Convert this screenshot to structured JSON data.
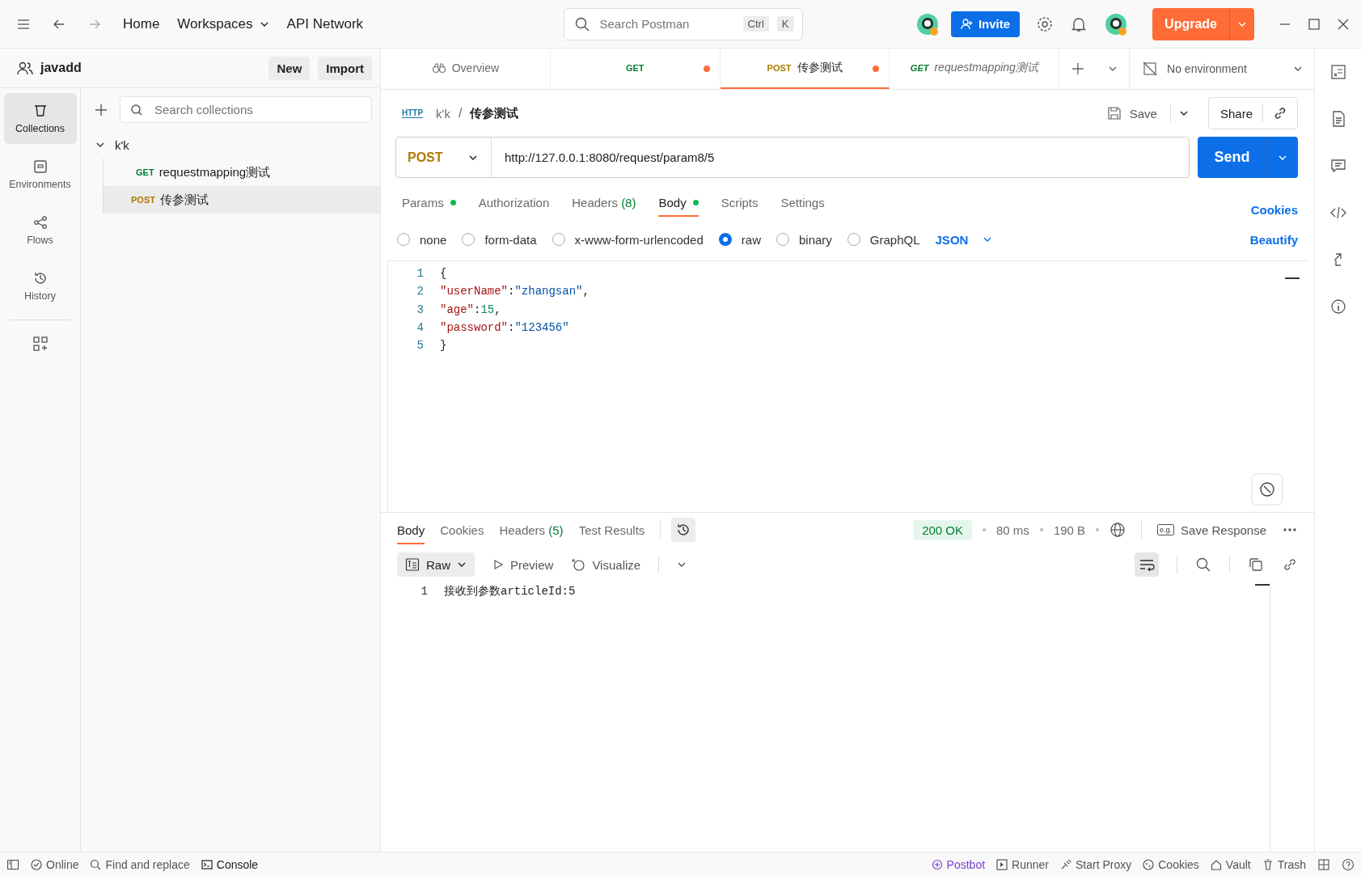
{
  "topbar": {
    "nav": [
      "Home",
      "Workspaces",
      "API Network"
    ],
    "search": {
      "placeholder": "Search Postman",
      "keys": [
        "Ctrl",
        "K"
      ]
    },
    "invite": "Invite",
    "upgrade": "Upgrade"
  },
  "workspace": {
    "name": "javadd",
    "buttons": [
      "New",
      "Import"
    ]
  },
  "nav": [
    {
      "kind": "collections",
      "label": "Collections",
      "selected": true
    },
    {
      "kind": "environments",
      "label": "Environments",
      "selected": false
    },
    {
      "kind": "flows",
      "label": "Flows",
      "selected": false
    },
    {
      "kind": "history",
      "label": "History",
      "selected": false
    }
  ],
  "collections": {
    "search": {
      "placeholder": "Search collections"
    },
    "tree": [
      {
        "name": "k'k",
        "expanded": true,
        "children": [
          {
            "method": "GET",
            "name": "requestmapping测试",
            "selected": false
          },
          {
            "method": "POST",
            "name": "传参测试",
            "selected": true
          }
        ]
      }
    ]
  },
  "tabs": [
    {
      "kind": "overview",
      "label": "Overview",
      "selected": false,
      "unsaved": false,
      "preview": false
    },
    {
      "kind": "request",
      "method": "GET",
      "selected": false,
      "unsaved": true,
      "preview": false
    },
    {
      "kind": "request",
      "method": "POST",
      "label": "传参测试",
      "selected": true,
      "unsaved": true,
      "preview": false
    },
    {
      "kind": "request",
      "method": "GET",
      "label": "requestmapping测试",
      "selected": false,
      "unsaved": false,
      "preview": true
    }
  ],
  "environment": "No environment",
  "request": {
    "protocol": "HTTP",
    "breadcrumb": [
      "k'k",
      "传参测试"
    ],
    "separator": "/",
    "save": "Save",
    "share": "Share",
    "method": "POST",
    "url": "http://127.0.0.1:8080/request/param8/5",
    "send": "Send",
    "tabs": [
      {
        "label": "Params",
        "dot": true,
        "selected": false
      },
      {
        "label": "Authorization",
        "dot": false,
        "selected": false
      },
      {
        "label": "Headers",
        "count": "(8)",
        "dot": false,
        "selected": false
      },
      {
        "label": "Body",
        "dot": true,
        "selected": true
      },
      {
        "label": "Scripts",
        "dot": false,
        "selected": false
      },
      {
        "label": "Settings",
        "dot": false,
        "selected": false
      }
    ],
    "cookies": "Cookies",
    "body_types": [
      {
        "label": "none",
        "selected": false
      },
      {
        "label": "form-data",
        "selected": false
      },
      {
        "label": "x-www-form-urlencoded",
        "selected": false
      },
      {
        "label": "raw",
        "selected": true
      },
      {
        "label": "binary",
        "selected": false
      },
      {
        "label": "GraphQL",
        "selected": false
      }
    ],
    "format": "JSON",
    "beautify": "Beautify",
    "code": [
      {
        "number": "1",
        "tokens": [
          {
            "kind": "punct",
            "text": "{"
          }
        ]
      },
      {
        "number": "2",
        "tokens": [
          {
            "kind": "key",
            "text": "\"userName\""
          },
          {
            "kind": "punct",
            "text": ":"
          },
          {
            "kind": "string",
            "text": "\"zhangsan\""
          },
          {
            "kind": "punct",
            "text": ","
          }
        ]
      },
      {
        "number": "3",
        "tokens": [
          {
            "kind": "key",
            "text": "\"age\""
          },
          {
            "kind": "punct",
            "text": ":"
          },
          {
            "kind": "number",
            "text": "15"
          },
          {
            "kind": "punct",
            "text": ","
          }
        ]
      },
      {
        "number": "4",
        "tokens": [
          {
            "kind": "key",
            "text": "\"password\""
          },
          {
            "kind": "punct",
            "text": ":"
          },
          {
            "kind": "string",
            "text": "\"123456\""
          }
        ]
      },
      {
        "number": "5",
        "tokens": [
          {
            "kind": "punct",
            "text": "}"
          }
        ]
      }
    ]
  },
  "response": {
    "tabs": [
      {
        "label": "Body",
        "selected": true
      },
      {
        "label": "Cookies",
        "selected": false
      },
      {
        "label": "Headers",
        "count": "(5)",
        "selected": false
      },
      {
        "label": "Test Results",
        "selected": false
      }
    ],
    "status": "200 OK",
    "time": "80 ms",
    "size": "190 B",
    "save_response_icon": "e.g.",
    "save_response": "Save Response",
    "view": "Raw",
    "preview": "Preview",
    "visualize": "Visualize",
    "lines": [
      {
        "number": "1",
        "text": "接收到参数articleId:5"
      }
    ]
  },
  "status_bar": {
    "left": [
      {
        "kind": "online",
        "label": "Online"
      },
      {
        "kind": "find",
        "label": "Find and replace"
      },
      {
        "kind": "console",
        "label": "Console"
      }
    ],
    "right": [
      {
        "kind": "postbot",
        "label": "Postbot"
      },
      {
        "kind": "runner",
        "label": "Runner"
      },
      {
        "kind": "proxy",
        "label": "Start Proxy"
      },
      {
        "kind": "cookies",
        "label": "Cookies"
      },
      {
        "kind": "vault",
        "label": "Vault"
      },
      {
        "kind": "trash",
        "label": "Trash"
      }
    ]
  }
}
